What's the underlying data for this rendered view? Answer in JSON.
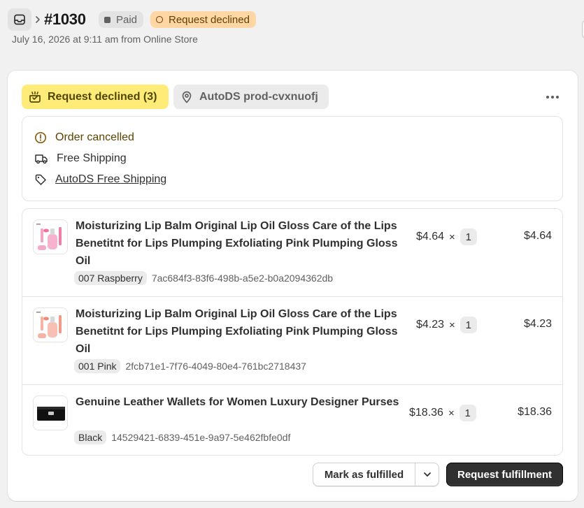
{
  "header": {
    "order_number": "#1030",
    "payment_badge": "Paid",
    "status_badge": "Request declined",
    "meta": "July 16, 2026 at 9:11 am from Online Store"
  },
  "fulfillment_card": {
    "status_chip": "Request declined (3)",
    "location_chip": "AutoDS prod-cvxnuofj",
    "info": {
      "cancelled": "Order cancelled",
      "shipping": "Free Shipping",
      "shipping_link": "AutoDS Free Shipping"
    },
    "items": [
      {
        "title": "Moisturizing Lip Balm Original Lip Oil Gloss Care of the Lips Benetitnt for Lips Plumping Exfoliating Pink Plumping Gloss Oil",
        "variant": "007 Raspberry",
        "sku": "7ac684f3-83f6-498b-a5e2-b0a2094362db",
        "price": "$4.64",
        "times": "×",
        "qty": "1",
        "total": "$4.64"
      },
      {
        "title": "Moisturizing Lip Balm Original Lip Oil Gloss Care of the Lips Benetitnt for Lips Plumping Exfoliating Pink Plumping Gloss Oil",
        "variant": "001 Pink",
        "sku": "2fcb71e1-7f76-4049-80e4-761bc2718437",
        "price": "$4.23",
        "times": "×",
        "qty": "1",
        "total": "$4.23"
      },
      {
        "title": "Genuine Leather Wallets for Women Luxury Designer Purses",
        "variant": "Black",
        "sku": "14529421-6839-451e-9a97-5e462fbfe0df",
        "price": "$18.36",
        "times": "×",
        "qty": "1",
        "total": "$18.36"
      }
    ],
    "actions": {
      "mark_fulfilled": "Mark as fulfilled",
      "request_fulfillment": "Request fulfillment"
    }
  },
  "colors": {
    "declined_chip_bg": "#ffeb78",
    "declined_badge_bg": "#ffd6a4",
    "primary_button_bg": "#303030"
  }
}
